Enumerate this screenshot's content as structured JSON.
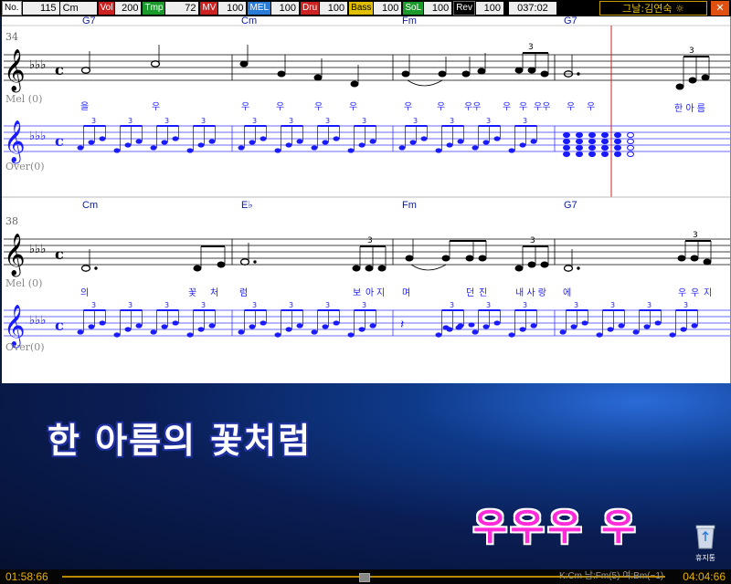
{
  "topbar": {
    "no_label": "No.",
    "no_value": "115",
    "key_value": "Cm",
    "vol_label": "Vol",
    "vol_value": "200",
    "tmp_label": "Tmp",
    "tmp_value": "72",
    "mv_label": "MV",
    "mv_value": "100",
    "mel_label": "MEL",
    "mel_value": "100",
    "dru_label": "Dru",
    "dru_value": "100",
    "bass_label": "Bass",
    "bass_value": "100",
    "sol_label": "SoL",
    "sol_value": "100",
    "rev_label": "Rev",
    "rev_value": "100",
    "time_value": "037:02",
    "singer": "그날:김연숙 ☼",
    "win_button": "✕"
  },
  "score": {
    "system1": {
      "measure_number": "34",
      "chords": [
        "G7",
        "Cm",
        "Fm",
        "G7"
      ],
      "mel_label": "Mel (0)",
      "over_label": "Over(0)",
      "lyrics": [
        "을",
        "우",
        "우",
        "우",
        "우",
        "우",
        "우",
        "우",
        "우우",
        "우",
        "우",
        "우우",
        "우",
        "우",
        "한 아 름"
      ],
      "triplet": "3"
    },
    "system2": {
      "measure_number": "38",
      "chords": [
        "Cm",
        "E♭",
        "Fm",
        "G7"
      ],
      "mel_label": "Mel (0)",
      "over_label": "Over(0)",
      "lyrics": [
        "의",
        "꽃",
        "처",
        "럼",
        "보",
        "아",
        "지",
        "며",
        "던",
        "진",
        "내 사 랑",
        "에",
        "우",
        "우",
        "지"
      ],
      "triplet": "3"
    }
  },
  "karaoke": {
    "current_line": "한 아름의 꽃처럼",
    "next_line": "우우우 우"
  },
  "desktop": {
    "recycle_label": "휴지통"
  },
  "bottombar": {
    "elapsed": "01:58:66",
    "total": "04:04:66",
    "status": "K:Cm 남:Fm(5) 여:Bm(−1)",
    "progress": 0.5
  },
  "colors": {
    "accent_gold": "#e8b000",
    "lyric_pink": "#ff2ad8",
    "note_blue": "#1a1aff",
    "playhead_red": "#d02020"
  }
}
